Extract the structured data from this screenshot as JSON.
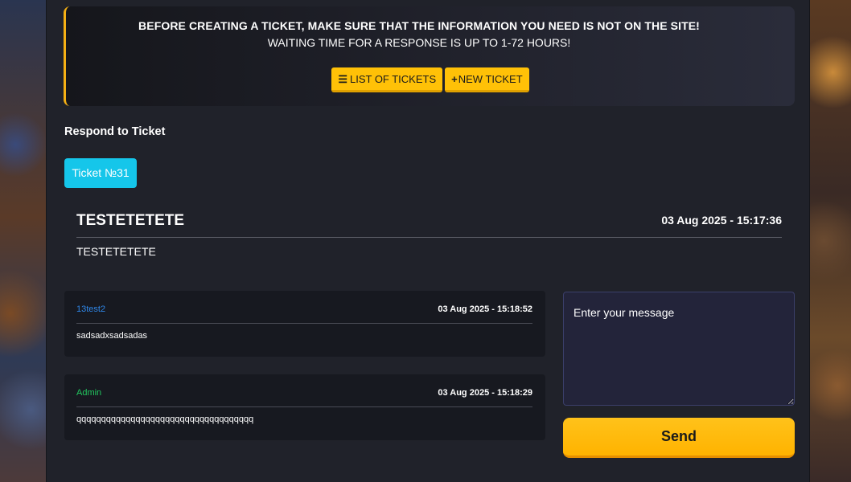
{
  "notice": {
    "line1": "BEFORE CREATING A TICKET, MAKE SURE THAT THE INFORMATION YOU NEED IS NOT ON THE SITE!",
    "line2": "WAITING TIME FOR A RESPONSE IS UP TO 1-72 HOURS!",
    "list_button": {
      "icon": "list-icon",
      "label": "LIST OF TICKETS"
    },
    "new_button": {
      "icon": "plus-icon",
      "label": "NEW TICKET"
    },
    "accent_color": "#f5b014"
  },
  "respond": {
    "title": "Respond to Ticket",
    "ticket_badge": "Ticket №31",
    "badge_color": "#15c6ea"
  },
  "ticket": {
    "subject": "TESTETETETE",
    "date": "03 Aug 2025 - 15:17:36",
    "body": "TESTETETETE"
  },
  "messages": [
    {
      "author": "13test2",
      "date": "03 Aug 2025 - 15:18:52",
      "text": "sadsadxsadsadas",
      "author_color": "#2f86e6"
    },
    {
      "author": "Admin",
      "date": "03 Aug 2025 - 15:18:29",
      "text": "qqqqqqqqqqqqqqqqqqqqqqqqqqqqqqqqqqqq",
      "author_color": "#22c55e"
    }
  ],
  "reply": {
    "placeholder": "Enter your message",
    "send_label": "Send"
  }
}
